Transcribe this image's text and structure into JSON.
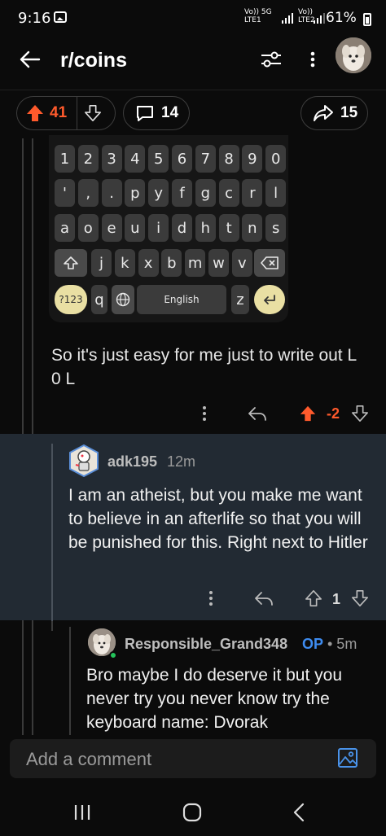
{
  "status_bar": {
    "time": "9:16",
    "network_label_1": "Vo)) 5G",
    "network_sub_1": "LTE1",
    "network_label_2": "Vo))",
    "network_sub_2": "LTE2",
    "battery": "61%"
  },
  "header": {
    "title": "r/coins",
    "back_icon": "arrow-left-icon",
    "filter_icon": "sliders-icon",
    "more_icon": "more-vertical-icon"
  },
  "post_actions": {
    "upvotes": "41",
    "comments": "14",
    "shares": "15"
  },
  "keyboard_image": {
    "row1": [
      "1",
      "2",
      "3",
      "4",
      "5",
      "6",
      "7",
      "8",
      "9",
      "0"
    ],
    "row2": [
      "'",
      ",",
      ".",
      "p",
      "y",
      "f",
      "g",
      "c",
      "r",
      "l"
    ],
    "row3": [
      "a",
      "o",
      "e",
      "u",
      "i",
      "d",
      "h",
      "t",
      "n",
      "s"
    ],
    "row4": [
      "j",
      "k",
      "x",
      "b",
      "m",
      "w",
      "v"
    ],
    "symbols_key": "?123",
    "q_key": "q",
    "space_label": "English",
    "z_key": "z"
  },
  "comment_1": {
    "text": "So it's just easy for me just to write out L 0 L",
    "score": "-2"
  },
  "comment_2": {
    "username": "adk195",
    "time": "12m",
    "text": "I am an atheist, but you make me want to believe in an afterlife so that you will be punished for this. Right next to Hitler",
    "score": "1"
  },
  "comment_3": {
    "username": "Responsible_Grand348",
    "op_badge": "OP",
    "time": "• 5m",
    "text": "Bro maybe I do deserve it but you never try you never know try the keyboard name: Dvorak"
  },
  "comment_input": {
    "placeholder": "Add a comment"
  },
  "colors": {
    "upvote_orange": "#ff5a2c",
    "op_blue": "#3e8cf0",
    "highlight_bg": "#222a33",
    "online_green": "#23c35a"
  }
}
